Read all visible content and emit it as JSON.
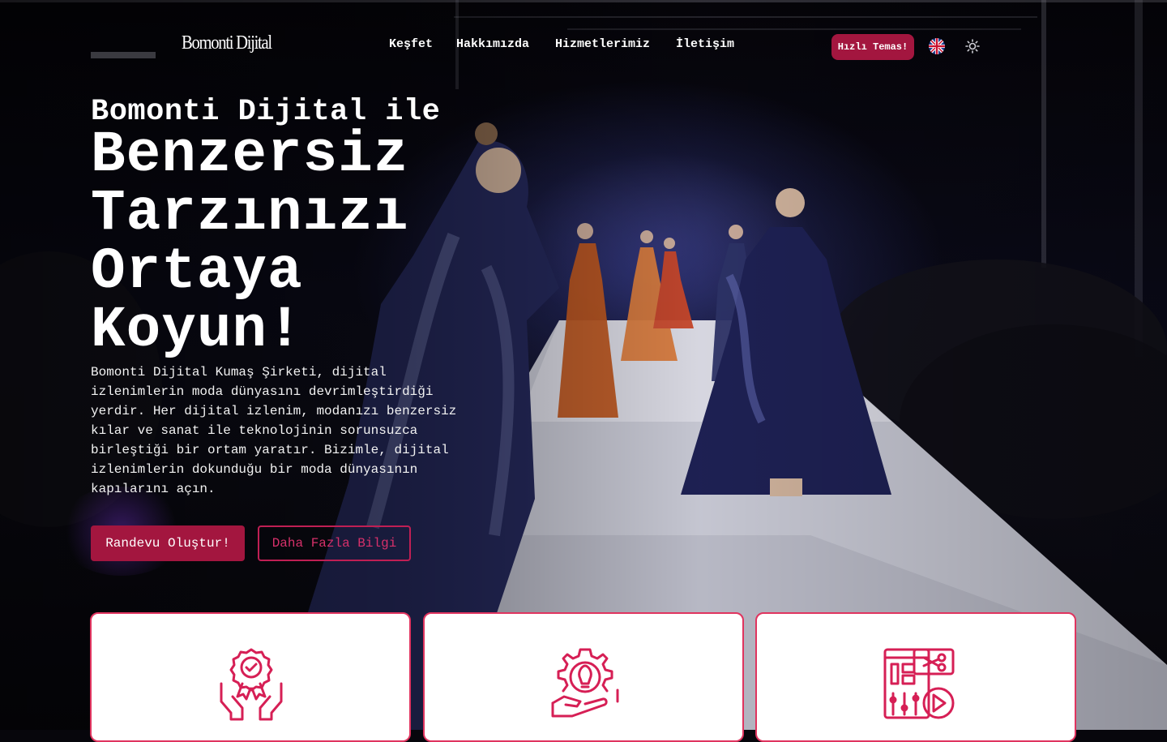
{
  "nav": {
    "brand": "Bomonti Dijital",
    "menu": [
      "Keşfet",
      "Hakkımızda",
      "Hizmetlerimiz",
      "İletişim"
    ],
    "cta_label": "Hızlı Temas!",
    "language_icon": "uk-flag-icon",
    "theme_icon": "sun-icon"
  },
  "hero": {
    "pre_title": "Bomonti Dijital ile",
    "headline": "Benzersiz Tarzınızı Ortaya Koyun!",
    "description": "Bomonti Dijital Kumaş Şirketi, dijital izlenimlerin moda dünyasını devrimleştirdiği yerdir. Her dijital izlenim, modanızı benzersiz kılar ve sanat ile teknolojinin sorunsuzca birleştiği bir ortam yaratır. Bizimle, dijital izlenimlerin dokunduğu bir moda dünyasının kapılarını açın.",
    "primary_button": "Randevu Oluştur!",
    "secondary_button": "Daha Fazla Bilgi"
  },
  "cards": [
    {
      "icon": "award-hands-icon"
    },
    {
      "icon": "idea-gear-icon"
    },
    {
      "icon": "editing-tools-icon"
    }
  ],
  "colors": {
    "accent": "#a3163f",
    "accent_outline": "#e0345f",
    "background": "#07060c"
  }
}
